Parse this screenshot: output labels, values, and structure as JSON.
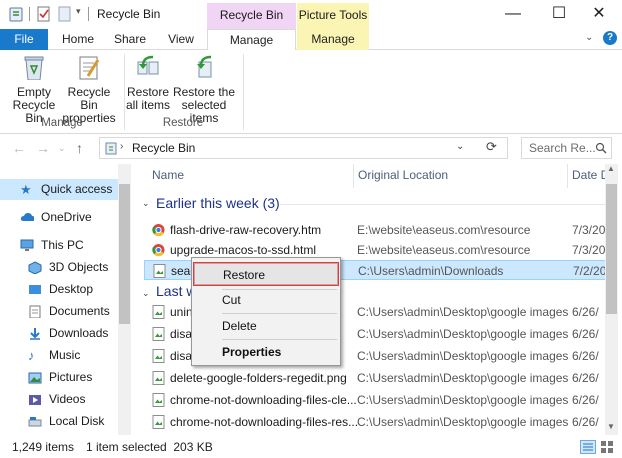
{
  "window": {
    "title": "Recycle Bin",
    "contextual_tabs": [
      "Recycle Bin Tools",
      "Picture Tools"
    ],
    "controls": [
      "—",
      "☐",
      "✕"
    ]
  },
  "tabs": {
    "file": "File",
    "home": "Home",
    "share": "Share",
    "view": "View",
    "manage1": "Manage",
    "manage2": "Manage"
  },
  "ribbon": {
    "empty": [
      "Empty",
      "Recycle Bin"
    ],
    "props": [
      "Recycle Bin",
      "properties"
    ],
    "restore_all": [
      "Restore",
      "all items"
    ],
    "restore_sel": [
      "Restore the",
      "selected items"
    ],
    "group_manage": "Manage",
    "group_restore": "Restore"
  },
  "address": {
    "path": "Recycle Bin",
    "search_placeholder": "Search Re..."
  },
  "nav": [
    {
      "label": "Quick access",
      "icon": "star-icon"
    },
    {
      "label": "OneDrive",
      "icon": "cloud-icon"
    },
    {
      "label": "This PC",
      "icon": "computer-icon"
    },
    {
      "label": "3D Objects",
      "icon": "cube-icon"
    },
    {
      "label": "Desktop",
      "icon": "desktop-icon"
    },
    {
      "label": "Documents",
      "icon": "documents-icon"
    },
    {
      "label": "Downloads",
      "icon": "download-icon"
    },
    {
      "label": "Music",
      "icon": "music-icon"
    },
    {
      "label": "Pictures",
      "icon": "pictures-icon"
    },
    {
      "label": "Videos",
      "icon": "videos-icon"
    },
    {
      "label": "Local Disk (C:)",
      "icon": "disk-icon"
    }
  ],
  "columns": {
    "name": "Name",
    "location": "Original Location",
    "date": "Date D"
  },
  "groups": {
    "earlier": "Earlier this week (3)",
    "last": "Last w"
  },
  "rows": [
    {
      "name": "flash-drive-raw-recovery.htm",
      "loc": "E:\\website\\easeus.com\\resource",
      "date": "7/3/20"
    },
    {
      "name": "upgrade-macos-to-ssd.html",
      "loc": "E:\\website\\easeus.com\\resource",
      "date": "7/3/20"
    },
    {
      "name": "seag",
      "loc": "C:\\Users\\admin\\Downloads",
      "date": "7/2/20"
    },
    {
      "name": "unin",
      "loc": "C:\\Users\\admin\\Desktop\\google images",
      "date": "6/26/"
    },
    {
      "name": "disal",
      "loc": "C:\\Users\\admin\\Desktop\\google images",
      "date": "6/26/"
    },
    {
      "name": "disal",
      "loc": "C:\\Users\\admin\\Desktop\\google images",
      "date": "6/26/"
    },
    {
      "name": "delete-google-folders-regedit.png",
      "loc": "C:\\Users\\admin\\Desktop\\google images",
      "date": "6/26/"
    },
    {
      "name": "chrome-not-downloading-files-cle...",
      "loc": "C:\\Users\\admin\\Desktop\\google images",
      "date": "6/26/"
    },
    {
      "name": "chrome-not-downloading-files-res...",
      "loc": "C:\\Users\\admin\\Desktop\\google images",
      "date": "6/26/"
    }
  ],
  "context_menu": {
    "restore": "Restore",
    "cut": "Cut",
    "delete": "Delete",
    "properties": "Properties"
  },
  "status": {
    "count": "1,249 items",
    "selected": "1 item selected  203 KB"
  },
  "colors": {
    "file_tab": "#1979ca",
    "recycle_tools": "#f0d6f4",
    "picture_tools": "#fbf5b4",
    "selection": "#cce8ff",
    "group_header": "#1e3287"
  }
}
